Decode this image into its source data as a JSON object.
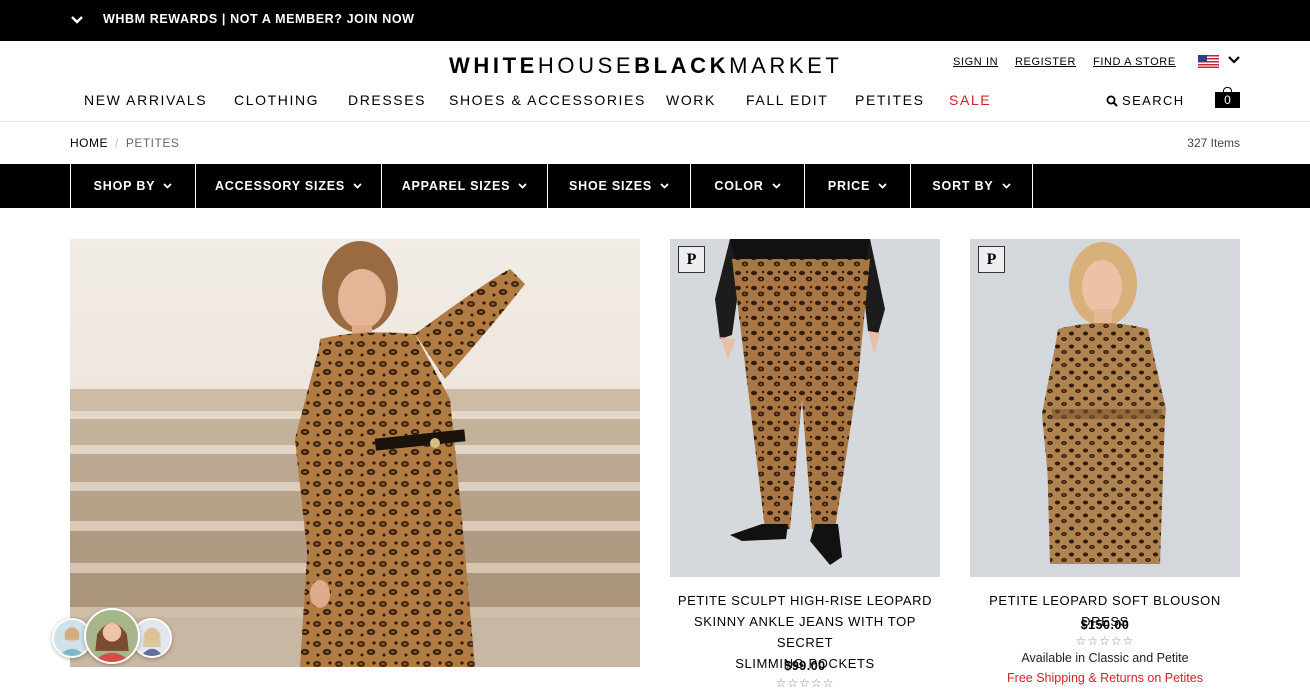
{
  "promo": {
    "text": "WHBM REWARDS | NOT A MEMBER? JOIN NOW",
    "icon": "chevron-down-icon"
  },
  "logo": {
    "part1": "WHITE",
    "part2": "HOUSE",
    "part3": "BLACK",
    "part4": "MARKET"
  },
  "account": {
    "sign_in": "SIGN IN",
    "register": "REGISTER",
    "find_store": "FIND A STORE",
    "flag_icon": "us-flag-icon"
  },
  "nav": {
    "items": [
      "NEW ARRIVALS",
      "CLOTHING",
      "DRESSES",
      "SHOES & ACCESSORIES",
      "WORK",
      "FALL EDIT",
      "PETITES",
      "SALE"
    ],
    "search_label": "SEARCH",
    "bag_count": "0"
  },
  "breadcrumb": {
    "home": "HOME",
    "separator": "/",
    "current": "PETITES"
  },
  "item_count": "327 Items",
  "filters": [
    "SHOP BY",
    "ACCESSORY SIZES",
    "APPAREL SIZES",
    "SHOE SIZES",
    "COLOR",
    "PRICE",
    "SORT BY"
  ],
  "products": [
    {
      "badge": "P",
      "name_lines": [
        "PETITE SCULPT HIGH-RISE LEOPARD",
        "SKINNY ANKLE JEANS WITH TOP SECRET",
        "SLIMMING POCKETS"
      ],
      "price": "$99.00",
      "stars": "☆☆☆☆☆"
    },
    {
      "badge": "P",
      "name_lines": [
        "PETITE LEOPARD SOFT BLOUSON DRESS"
      ],
      "price": "$150.00",
      "stars": "☆☆☆☆☆",
      "availability": "Available in Classic and Petite",
      "shipping": "Free Shipping & Returns on Petites"
    }
  ],
  "colors": {
    "black": "#000000",
    "sale_red": "#d1222b",
    "leopard_base": "#a8793f"
  }
}
